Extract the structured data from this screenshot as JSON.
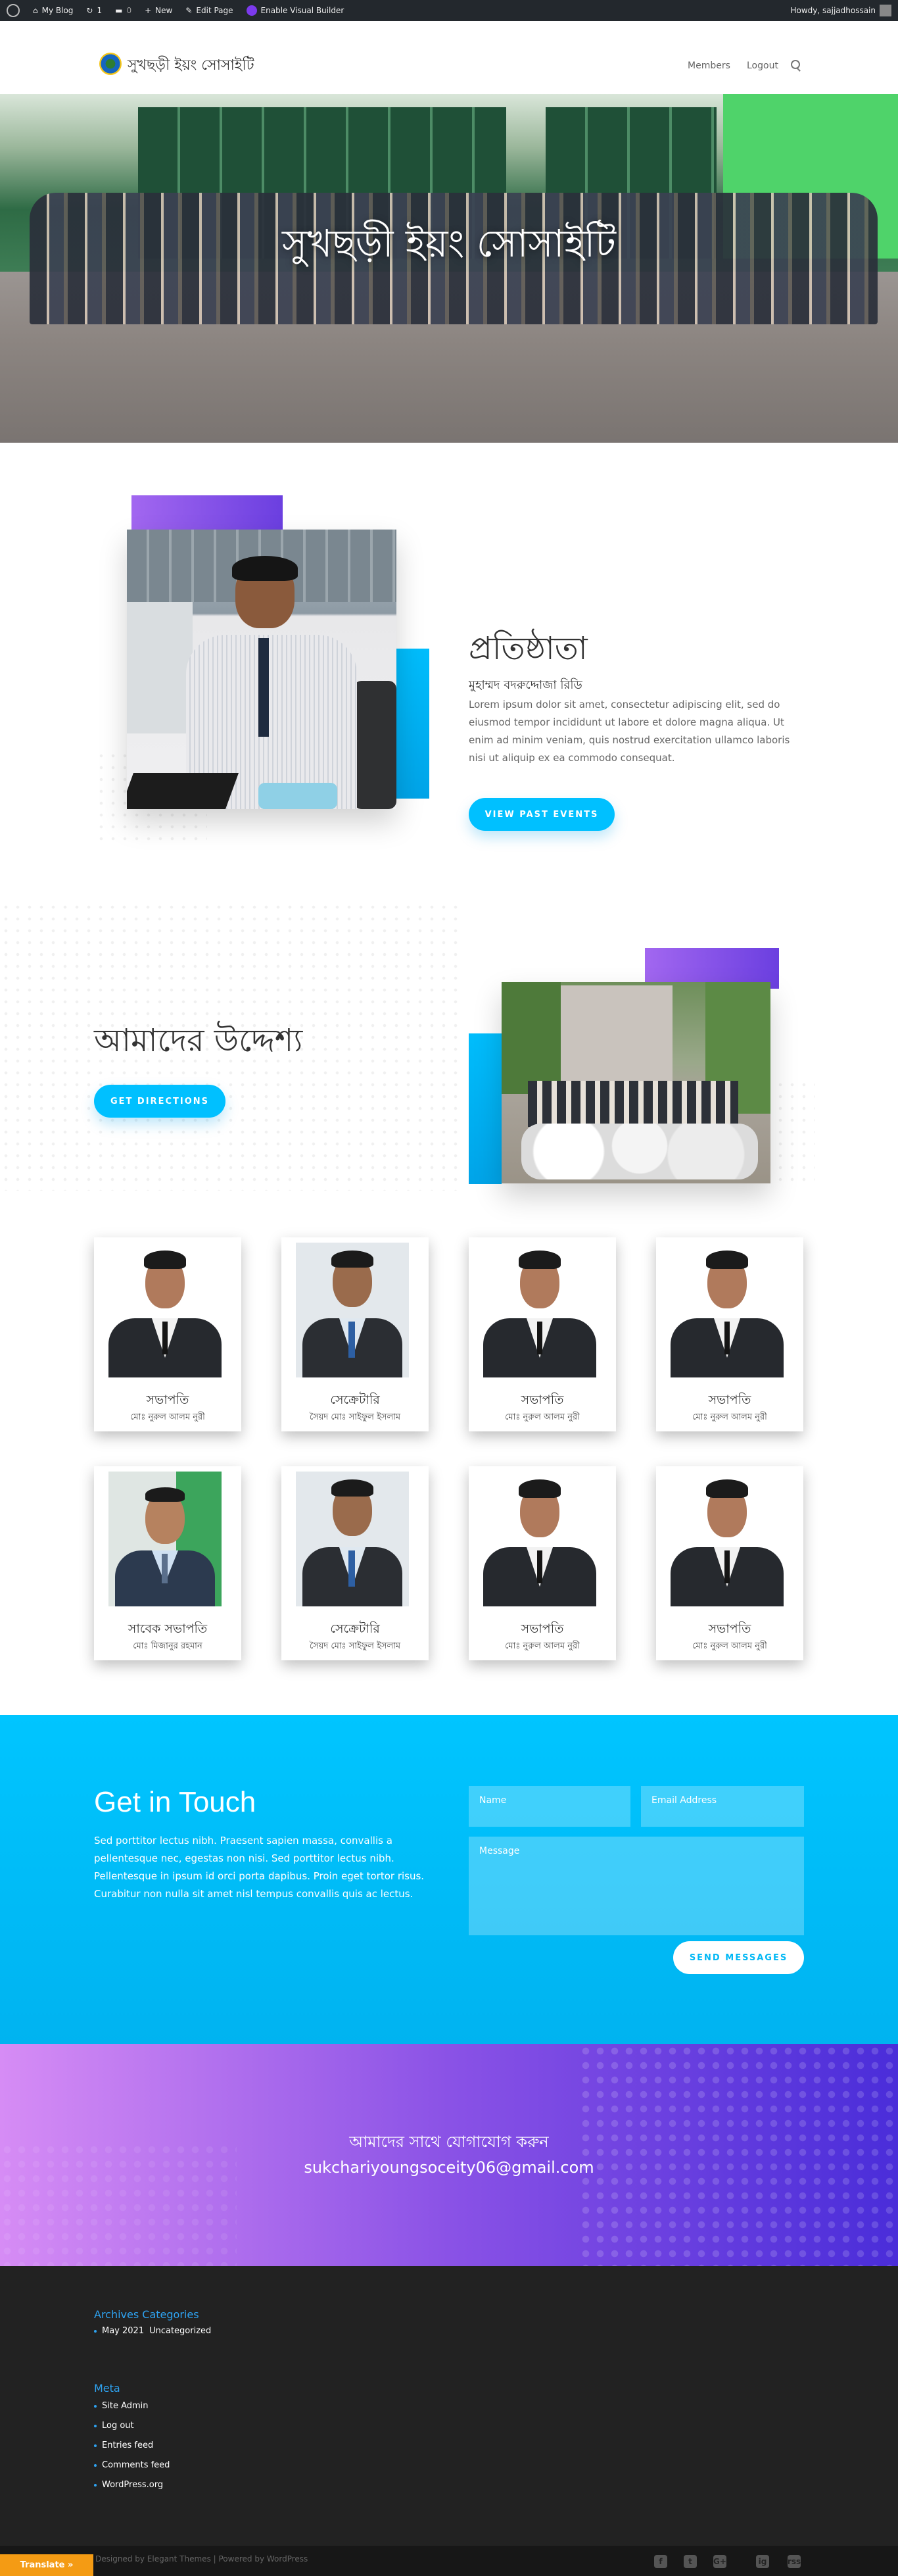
{
  "admin_bar": {
    "my_blog": "My Blog",
    "updates_count": "1",
    "comments_count": "0",
    "new": "New",
    "edit_page": "Edit Page",
    "visual_builder": "Enable Visual Builder",
    "howdy": "Howdy, sajjadhossain"
  },
  "header": {
    "site_title": "সুখছড়ী ইয়ং সোসাইটি",
    "nav": [
      "Members",
      "Logout"
    ]
  },
  "hero": {
    "title": "সুখছড়ী ইয়ং সোসাইটি"
  },
  "founder": {
    "heading": "প্রতিষ্ঠাতা",
    "name": "মুহাম্মদ বদরুদ্দোজা রিডি",
    "text": "Lorem ipsum dolor sit amet, consectetur adipiscing elit, sed do eiusmod tempor incididunt ut labore et dolore magna aliqua. Ut enim ad minim veniam, quis nostrud exercitation ullamco laboris nisi ut aliquip ex ea commodo consequat.",
    "button": "VIEW PAST EVENTS"
  },
  "mission": {
    "heading": "আমাদের উদ্দেশ্য",
    "button": "GET DIRECTIONS"
  },
  "team": [
    {
      "role": "সভাপতি",
      "name": "মোঃ নুরুল আলম নুরী"
    },
    {
      "role": "সেক্রেটারি",
      "name": "সৈয়দ মোঃ সাইফুল ইসলাম"
    },
    {
      "role": "সভাপতি",
      "name": "মোঃ নুরুল আলম নুরী"
    },
    {
      "role": "সভাপতি",
      "name": "মোঃ নুরুল আলম নুরী"
    },
    {
      "role": "সাবেক সভাপতি",
      "name": "মোঃ মিজানুর রহমান"
    },
    {
      "role": "সেক্রেটারি",
      "name": "সৈয়দ মোঃ সাইফুল ইসলাম"
    },
    {
      "role": "সভাপতি",
      "name": "মোঃ নুরুল আলম নুরী"
    },
    {
      "role": "সভাপতি",
      "name": "মোঃ নুরুল আলম নুরী"
    }
  ],
  "contact": {
    "heading": "Get in Touch",
    "text": "Sed porttitor lectus nibh. Praesent sapien massa, convallis a pellentesque nec, egestas non nisi. Sed porttitor lectus nibh. Pellentesque in ipsum id orci porta dapibus. Proin eget tortor risus. Curabitur non nulla sit amet nisl tempus convallis quis ac lectus.",
    "name_placeholder": "Name",
    "email_placeholder": "Email Address",
    "message_placeholder": "Message",
    "button": "SEND MESSAGES"
  },
  "cta": {
    "title": "আমাদের সাথে যোগাযোগ করুন",
    "email": "sukchariyoungsoceity06@gmail.com"
  },
  "footer": {
    "archives_title": "Archives Categories",
    "archives_item": "May 2021",
    "archives_cat": "Uncategorized",
    "meta_title": "Meta",
    "meta_items": [
      "Site Admin",
      "Log out",
      "Entries feed",
      "Comments feed",
      "WordPress.org"
    ],
    "credits": "Designed by Elegant Themes | Powered by WordPress",
    "translate": "Translate »",
    "social": [
      "f",
      "t",
      "G+",
      "ig",
      "rss"
    ]
  },
  "colors": {
    "accent": "#00c0ff",
    "purple": "#8a52e6",
    "footer_bg": "#222222"
  }
}
